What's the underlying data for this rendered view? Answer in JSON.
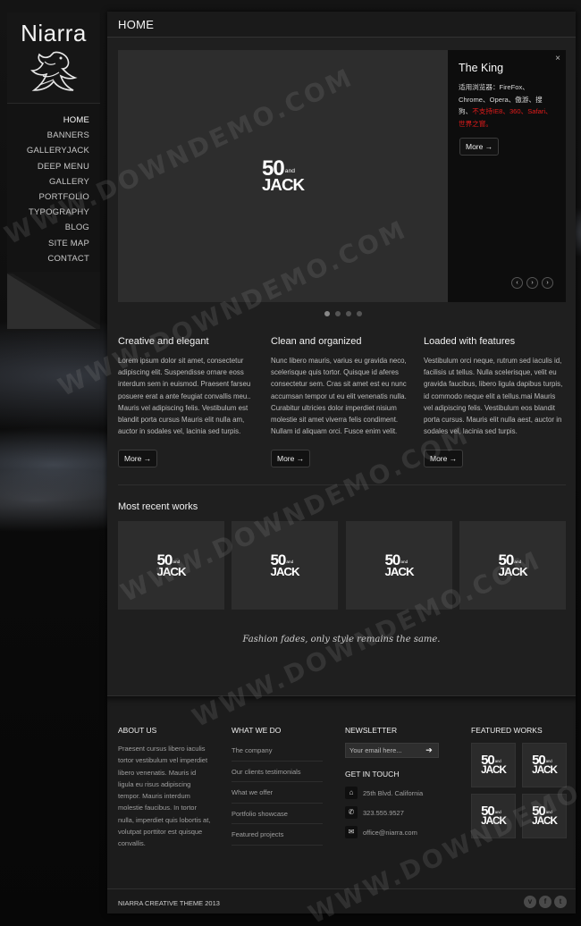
{
  "logo": {
    "text": "Niarra"
  },
  "nav": {
    "items": [
      "HOME",
      "BANNERS",
      "GALLERYJACK",
      "DEEP MENU",
      "GALLERY",
      "PORTFOLIO",
      "TYPOGRAPHY",
      "BLOG",
      "SITE MAP",
      "CONTACT"
    ],
    "active_index": 0
  },
  "page": {
    "title": "HOME"
  },
  "slider": {
    "logo": {
      "n50": "50",
      "and": "and",
      "jack": "JACK"
    },
    "caption_title": "The King",
    "caption_line1": "适用浏览器：FireFox、Chrome、Opera、傲游、搜狗、",
    "caption_red": "不支持IE8、360、Safari、世界之窗。",
    "more_label": "More →",
    "close_glyph": "×",
    "prev_glyph": "‹",
    "pause_glyph": "›",
    "next_glyph": "›",
    "dot_count": 4,
    "active_dot": 0
  },
  "features": [
    {
      "title": "Creative and elegant",
      "text": "Lorem ipsum dolor sit amet, consectetur adipiscing elit. Suspendisse ornare eoss interdum sem in euismod. Praesent farseu posuere erat a ante feugiat convallis meu.. Mauris vel adipiscing felis. Vestibulum est blandit porta cursus Mauris elit nulla am, auctor in sodales vel, lacinia sed turpis.",
      "button": "More →"
    },
    {
      "title": "Clean and organized",
      "text": "Nunc libero mauris, varius eu gravida neco, scelerisque quis tortor. Quisque id aferes consectetur sem. Cras sit amet est eu nunc accumsan tempor ut eu elit venenatis nulla. Curabitur ultricies dolor imperdiet nisium molestie sit amet viverra felis condiment. Nullam id aliquam orci. Fusce enim velit.",
      "button": "More →"
    },
    {
      "title": "Loaded with features",
      "text": "Vestibulum orci neque, rutrum sed iaculis id, facilisis ut tellus. Nulla scelerisque, velit eu gravida faucibus, libero ligula dapibus turpis, id commodo neque elit a tellus.mai Mauris vel adipiscing felis. Vestibulum eos blandit porta cursus. Mauris elit nulla aest, auctor in sodales vel, lacinia sed turpis.",
      "button": "More →"
    }
  ],
  "recent_works": {
    "title": "Most recent works",
    "thumb_logo": {
      "n50": "50",
      "and": "and",
      "jack": "JACK"
    }
  },
  "quote": "Fashion fades, only style remains the same.",
  "footer": {
    "about": {
      "heading": "ABOUT US",
      "text": "Praesent cursus libero iaculis tortor vestibulum vel imperdiet libero venenatis. Mauris id ligula eu risus adipiscing tempor. Mauris interdum molestie faucibus. In tortor nulla, imperdiet quis lobortis at, volutpat porttitor est quisque convallis."
    },
    "what_we_do": {
      "heading": "WHAT WE DO",
      "links": [
        "The company",
        "Our clients testimonials",
        "What we offer",
        "Portfolio showcase",
        "Featured projects"
      ]
    },
    "newsletter": {
      "heading": "NEWSLETTER",
      "placeholder": "Your email here...",
      "send_icon": "send-arrow-icon",
      "send_glyph": "➔"
    },
    "get_in_touch": {
      "heading": "GET IN TOUCH",
      "address": "25th Blvd. California",
      "phone": "323.555.9527",
      "email": "office@niarra.com",
      "glyphs": {
        "home": "⌂",
        "phone": "✆",
        "mail": "✉"
      }
    },
    "featured": {
      "heading": "FEATURED WORKS"
    }
  },
  "bottom_bar": {
    "copyright": "NIARRA CREATIVE THEME 2013",
    "social": [
      {
        "icon": "vimeo-icon",
        "glyph": "v"
      },
      {
        "icon": "facebook-icon",
        "glyph": "f"
      },
      {
        "icon": "twitter-icon",
        "glyph": "t"
      }
    ]
  },
  "watermark": "WWW.DOWNDEMO.COM",
  "colors": {
    "accent_red": "#e21b1b",
    "panel": "#1f1f1f",
    "background": "#0b0b0b"
  }
}
